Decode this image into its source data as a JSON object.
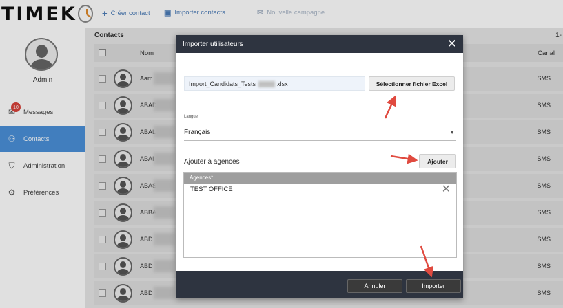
{
  "app": {
    "logo_text": "TIMEK",
    "logo_tail": "O"
  },
  "toolbar": {
    "create_contact": "Créer contact",
    "import_contacts": "Importer contacts",
    "new_campaign": "Nouvelle campagne"
  },
  "sidebar": {
    "user_name": "Admin",
    "items": [
      {
        "label": "Messages",
        "icon": "envelope-icon",
        "badge": "10"
      },
      {
        "label": "Contacts",
        "icon": "users-icon",
        "active": true
      },
      {
        "label": "Administration",
        "icon": "shield-icon"
      },
      {
        "label": "Préférences",
        "icon": "gear-icon"
      }
    ]
  },
  "contacts": {
    "title": "Contacts",
    "page_indicator": "1-",
    "columns": {
      "name": "Nom",
      "channel": "Canal"
    },
    "rows": [
      {
        "name": "Aam",
        "channel": "SMS"
      },
      {
        "name": "ABAD",
        "channel": "SMS"
      },
      {
        "name": "ABAL",
        "channel": "SMS"
      },
      {
        "name": "ABAI",
        "channel": "SMS"
      },
      {
        "name": "ABAS",
        "channel": "SMS"
      },
      {
        "name": "ABBA",
        "channel": "SMS"
      },
      {
        "name": "ABD",
        "channel": "SMS"
      },
      {
        "name": "ABD",
        "channel": "SMS"
      },
      {
        "name": "ABD",
        "channel": "SMS"
      }
    ]
  },
  "modal": {
    "title": "Importer utilisateurs",
    "file_name_prefix": "Import_Candidats_Tests",
    "file_name_suffix": "xlsx",
    "select_file_button": "Sélectionner fichier Excel",
    "language_label": "Langue",
    "language_value": "Français",
    "agencies_label": "Ajouter à agences",
    "add_button": "Ajouter",
    "agencies_header": "Agences*",
    "agencies": [
      "TEST OFFICE"
    ],
    "cancel_button": "Annuler",
    "import_button": "Importer"
  },
  "colors": {
    "accent": "#4a90d9",
    "modal_header": "#2e3440",
    "badge": "#d9433b",
    "annotation_arrow": "#e04a3f"
  }
}
